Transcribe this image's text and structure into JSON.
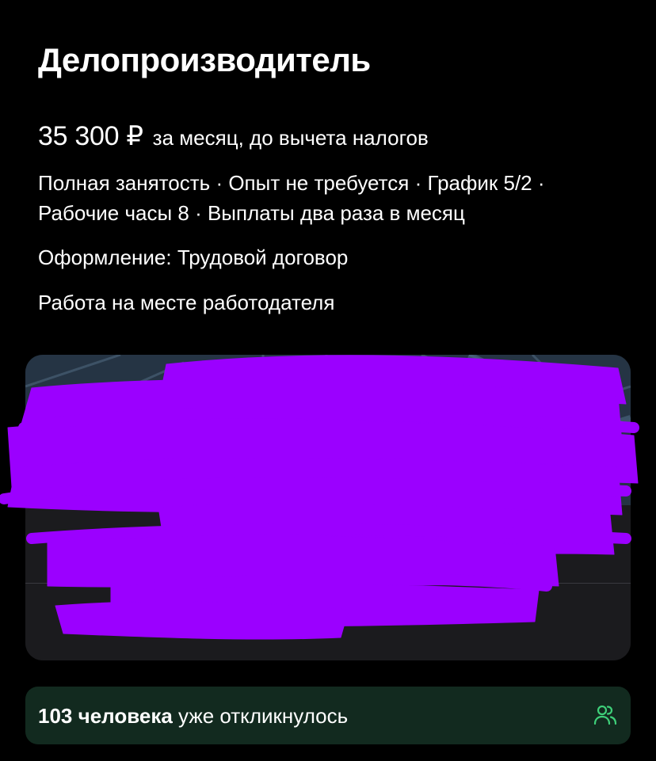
{
  "vacancy": {
    "title": "Делопроизводитель",
    "salary_amount": "35 300 ₽",
    "salary_note": "за месяц, до вычета налогов",
    "conditions": "Полная занятость · Опыт не требуется · График 5/2 · Рабочие часы 8 · Выплаты два раза в месяц",
    "contract": "Оформление: Трудовой договор",
    "workplace": "Работа на месте работодателя"
  },
  "responses": {
    "count_text": "103 человека",
    "suffix_text": " уже откликнулось",
    "icon": "people-icon"
  },
  "colors": {
    "background": "#000000",
    "text": "#ffffff",
    "scribble": "#9b00ff",
    "responses_bg": "#122a1f",
    "responses_icon": "#3ecf79",
    "map_bg": "#253444"
  }
}
